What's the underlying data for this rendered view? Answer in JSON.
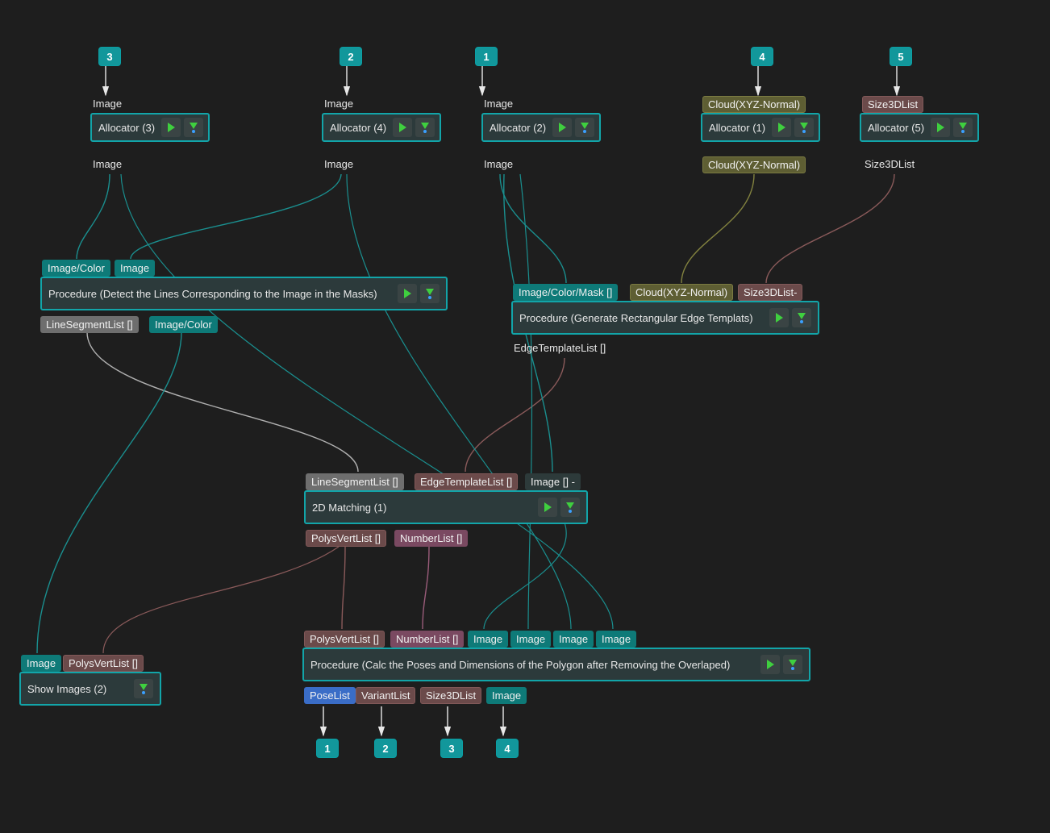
{
  "badges": {
    "b3": "3",
    "b2": "2",
    "b1": "1",
    "b4": "4",
    "b5": "5",
    "o1": "1",
    "o2": "2",
    "o3": "3",
    "o4": "4"
  },
  "ports": {
    "img": "Image",
    "imgColor": "Image/Color",
    "imgColorMaskArr": "Image/Color/Mask []",
    "cloud": "Cloud(XYZ-Normal)",
    "size3d": "Size3DList",
    "size3dDash": "Size3DList-",
    "lineSegArr": "LineSegmentList []",
    "edgeTplArr": "EdgeTemplateList []",
    "imgArrDash": "Image [] -",
    "polysArr": "PolysVertList []",
    "numArr": "NumberList []",
    "poseList": "PoseList",
    "variantList": "VariantList"
  },
  "nodes": {
    "alloc3": "Allocator (3)",
    "alloc4": "Allocator (4)",
    "alloc2": "Allocator (2)",
    "alloc1": "Allocator (1)",
    "alloc5": "Allocator (5)",
    "procDetect": "Procedure (Detect the Lines Corresponding to the Image in the Masks)",
    "procRect": "Procedure (Generate Rectangular Edge Templats)",
    "match2d": "2D Matching (1)",
    "procPoses": "Procedure (Calc the Poses and  Dimensions of the Polygon after Removing the Overlaped)",
    "showImg": "Show Images (2)"
  }
}
